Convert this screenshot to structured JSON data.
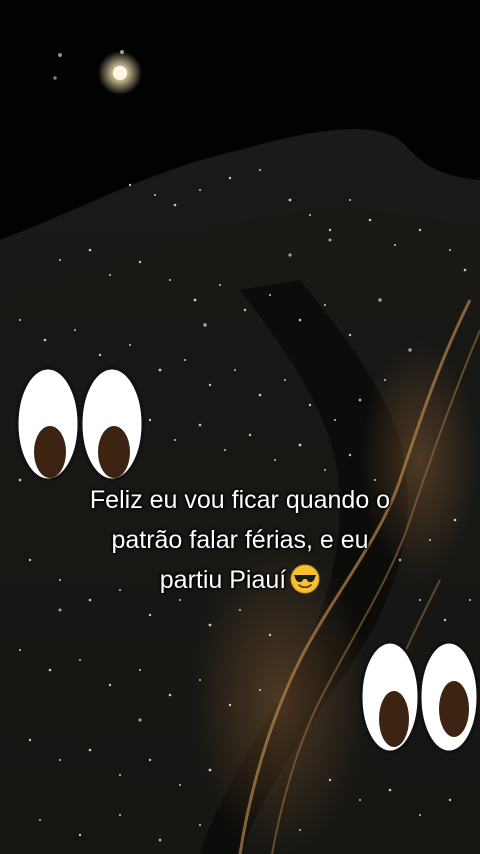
{
  "caption": {
    "line1": "Feliz eu vou ficar quando o",
    "line2": "patrão falar férias, e eu",
    "line3": "partiu Piauí"
  },
  "icons": {
    "eyes_top": "eyes-emoji-icon",
    "eyes_bottom": "eyes-emoji-icon",
    "caption_emoji": "smiling-face-with-sunglasses-icon"
  },
  "colors": {
    "background": "#020202",
    "text": "#ffffff",
    "city_light": "#f2e8c8",
    "road_light": "#b8844a"
  }
}
